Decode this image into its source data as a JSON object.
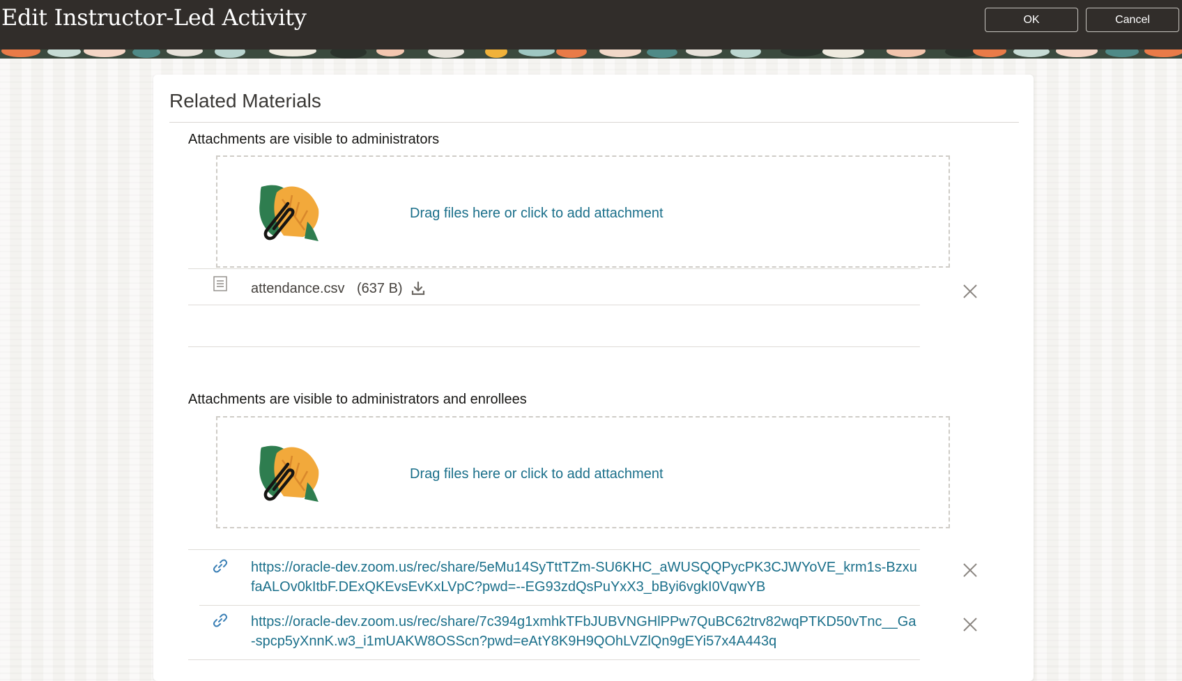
{
  "dialog": {
    "title": "Edit Instructor-Led Activity",
    "ok_label": "OK",
    "cancel_label": "Cancel"
  },
  "section": {
    "title": "Related Materials"
  },
  "admin_attachments": {
    "label": "Attachments are visible to administrators",
    "dropzone_text": "Drag files here or click to add attachment",
    "files": [
      {
        "name": "attendance.csv",
        "size": "(637 B)",
        "icon": "document-icon"
      }
    ]
  },
  "enrollee_attachments": {
    "label": "Attachments are visible to administrators and enrollees",
    "dropzone_text": "Drag files here or click to add attachment",
    "links": [
      {
        "url": "https://oracle-dev.zoom.us/rec/share/5eMu14SyTttTZm-SU6KHC_aWUSQQPycPK3CJWYoVE_krm1s-BzxufaALOv0kItbF.DExQKEvsEvKxLVpC?pwd=--EG93zdQsPuYxX3_bByi6vgkI0VqwYB",
        "icon": "link-icon"
      },
      {
        "url": "https://oracle-dev.zoom.us/rec/share/7c394g1xmhkTFbJUBVNGHlPPw7QuBC62trv82wqPTKD50vTnc__Ga-spcp5yXnnK.w3_i1mUAKW8OSScn?pwd=eAtY8K9H9QOhLVZlQn9gEYi57x4A443q",
        "icon": "link-icon"
      }
    ]
  },
  "colors": {
    "header_bg": "#312d2a",
    "link": "#1a6f8a",
    "leaf_orange": "#f2a93b",
    "leaf_green": "#2e7d4f"
  }
}
